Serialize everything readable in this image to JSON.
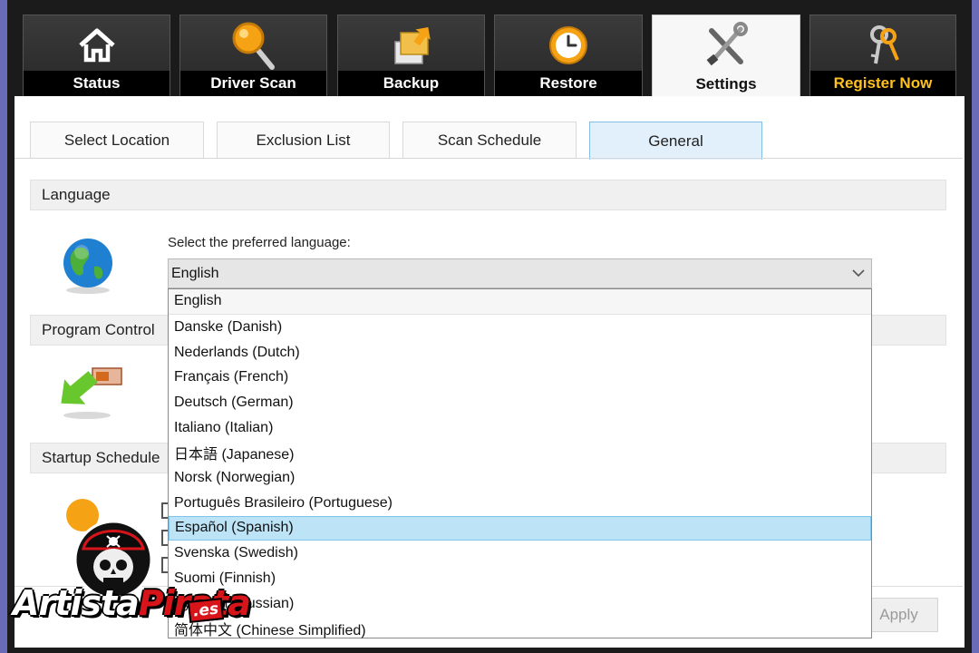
{
  "main_tabs": [
    {
      "label": "Status",
      "icon": "home-icon"
    },
    {
      "label": "Driver Scan",
      "icon": "magnifier-icon"
    },
    {
      "label": "Backup",
      "icon": "backup-folder-icon"
    },
    {
      "label": "Restore",
      "icon": "clock-restore-icon"
    },
    {
      "label": "Settings",
      "icon": "tools-icon",
      "active": true
    },
    {
      "label": "Register Now",
      "icon": "keys-icon",
      "color": "#ffc11f"
    }
  ],
  "sub_tabs": [
    {
      "label": "Select Location"
    },
    {
      "label": "Exclusion List"
    },
    {
      "label": "Scan Schedule"
    },
    {
      "label": "General",
      "active": true
    }
  ],
  "sections": {
    "language": {
      "title": "Language",
      "icon": "globe-icon"
    },
    "program_control": {
      "title": "Program Control",
      "icon": "arrow-shortcut-icon"
    },
    "startup_schedule": {
      "title": "Startup Schedule",
      "icon": "clock-icon"
    }
  },
  "language": {
    "prompt": "Select the preferred language:",
    "selected": "English",
    "options": [
      "English",
      "Danske (Danish)",
      "Nederlands (Dutch)",
      "Français (French)",
      "Deutsch (German)",
      "Italiano (Italian)",
      "日本語 (Japanese)",
      "Norsk (Norwegian)",
      "Português Brasileiro (Portuguese)",
      "Español (Spanish)",
      "Svenska (Swedish)",
      "Suomi (Finnish)",
      "Русский (Russian)",
      "简体中文 (Chinese Simplified)"
    ],
    "highlighted": "Español (Spanish)"
  },
  "apply_label": "Apply",
  "watermark": {
    "text_white": "Artista",
    "text_red": "Pirata",
    "suffix": ".es"
  },
  "colors": {
    "accent_register": "#ffc11f",
    "highlight": "#bde3f6",
    "active_subtab": "#e1f0fb"
  }
}
